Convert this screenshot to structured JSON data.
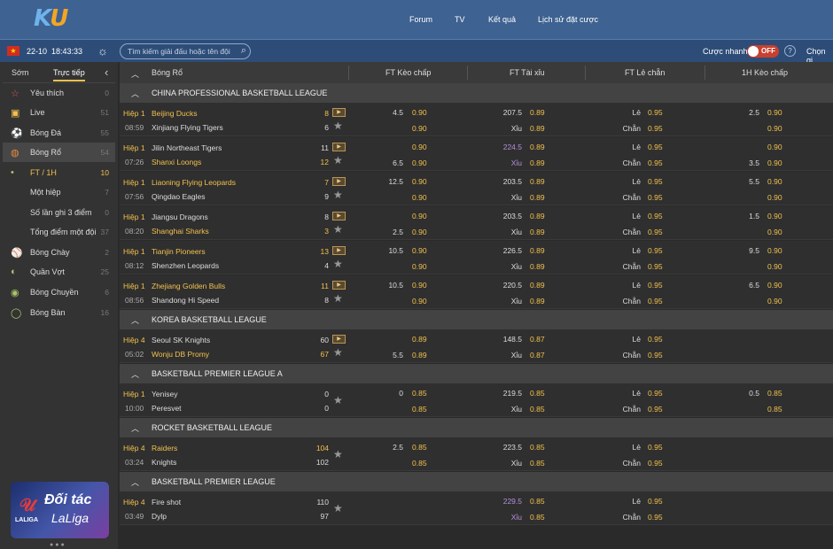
{
  "header": {
    "logo_k": "K",
    "logo_u": "U",
    "nav": [
      "Forum",
      "TV",
      "Kết quả",
      "Lịch sử đặt cược"
    ]
  },
  "topbar": {
    "flag": "★",
    "date": "22-10",
    "time": "18:43:33",
    "search_placeholder": "Tìm kiếm giải đấu hoặc tên đội",
    "quick_bet_label": "Cược nhanh",
    "toggle_state": "OFF",
    "help": "?",
    "select_label": "Chọn gi"
  },
  "sidebar": {
    "tabs": [
      "Sớm",
      "Trực tiếp"
    ],
    "collapse": "‹",
    "items": [
      {
        "icon": "☆",
        "label": "Yêu thích",
        "count": "0"
      },
      {
        "icon": "▣",
        "label": "Live",
        "count": "51"
      },
      {
        "icon": "⚽",
        "label": "Bóng Đá",
        "count": "55"
      },
      {
        "icon": "◍",
        "label": "Bóng Rổ",
        "count": "54"
      },
      {
        "icon": "•",
        "label": "FT / 1H",
        "count": "10"
      },
      {
        "icon": "",
        "label": "Một hiệp",
        "count": "7"
      },
      {
        "icon": "",
        "label": "Số lần ghi 3 điểm",
        "count": "0"
      },
      {
        "icon": "",
        "label": "Tổng điểm một đội",
        "count": "37"
      },
      {
        "icon": "⚾",
        "label": "Bóng Chày",
        "count": "2"
      },
      {
        "icon": "◐",
        "label": "Quần Vợt",
        "count": "25"
      },
      {
        "icon": "◉",
        "label": "Bóng Chuyền",
        "count": "6"
      },
      {
        "icon": "◯",
        "label": "Bóng Bàn",
        "count": "16"
      }
    ],
    "banner": {
      "line1": "Đối tác",
      "line2": "LaLiga",
      "brand": "LALIGA"
    }
  },
  "table": {
    "columns": [
      "Bóng Rổ",
      "FT Kèo chấp",
      "FT Tài xỉu",
      "FT Lẻ chẵn",
      "1H Kèo chấp"
    ],
    "leagues": [
      {
        "name": "CHINA PROFESSIONAL BASKETBALL LEAGUE",
        "matches": [
          {
            "period": "Hiệp 1",
            "time": "08:59",
            "home": "Beijing Ducks",
            "away": "Xinjiang Flying Tigers",
            "hs": "8",
            "as": "6",
            "fav": "home",
            "tv": true,
            "ft_hc": [
              "4.5",
              "0.90",
              "",
              "0.90"
            ],
            "ft_ou": [
              "207.5",
              "0.89",
              "Xỉu",
              "0.89"
            ],
            "ou_purple": false,
            "oe": [
              "Lẻ",
              "0.95",
              "Chẵn",
              "0.95"
            ],
            "h1": [
              "2.5",
              "0.90",
              "",
              "0.90"
            ]
          },
          {
            "period": "Hiệp 1",
            "time": "07:26",
            "home": "Jilin Northeast Tigers",
            "away": "Shanxi Loongs",
            "hs": "11",
            "as": "12",
            "fav": "away",
            "tv": true,
            "ft_hc": [
              "",
              "0.90",
              "6.5",
              "0.90"
            ],
            "ft_ou": [
              "224.5",
              "0.89",
              "Xỉu",
              "0.89"
            ],
            "ou_purple": true,
            "oe": [
              "Lẻ",
              "0.95",
              "Chẵn",
              "0.95"
            ],
            "h1": [
              "",
              "0.90",
              "3.5",
              "0.90"
            ]
          },
          {
            "period": "Hiệp 1",
            "time": "07:56",
            "home": "Liaoning Flying Leopards",
            "away": "Qingdao Eagles",
            "hs": "7",
            "as": "9",
            "fav": "home",
            "tv": true,
            "ft_hc": [
              "12.5",
              "0.90",
              "",
              "0.90"
            ],
            "ft_ou": [
              "203.5",
              "0.89",
              "Xỉu",
              "0.89"
            ],
            "ou_purple": false,
            "oe": [
              "Lẻ",
              "0.95",
              "Chẵn",
              "0.95"
            ],
            "h1": [
              "5.5",
              "0.90",
              "",
              "0.90"
            ]
          },
          {
            "period": "Hiệp 1",
            "time": "08:20",
            "home": "Jiangsu Dragons",
            "away": "Shanghai Sharks",
            "hs": "8",
            "as": "3",
            "fav": "away",
            "tv": true,
            "ft_hc": [
              "",
              "0.90",
              "2.5",
              "0.90"
            ],
            "ft_ou": [
              "203.5",
              "0.89",
              "Xỉu",
              "0.89"
            ],
            "ou_purple": false,
            "oe": [
              "Lẻ",
              "0.95",
              "Chẵn",
              "0.95"
            ],
            "h1": [
              "1.5",
              "0.90",
              "",
              "0.90"
            ]
          },
          {
            "period": "Hiệp 1",
            "time": "08:12",
            "home": "Tianjin Pioneers",
            "away": "Shenzhen Leopards",
            "hs": "13",
            "as": "4",
            "fav": "home",
            "tv": true,
            "ft_hc": [
              "10.5",
              "0.90",
              "",
              "0.90"
            ],
            "ft_ou": [
              "226.5",
              "0.89",
              "Xỉu",
              "0.89"
            ],
            "ou_purple": false,
            "oe": [
              "Lẻ",
              "0.95",
              "Chẵn",
              "0.95"
            ],
            "h1": [
              "9.5",
              "0.90",
              "",
              "0.90"
            ]
          },
          {
            "period": "Hiệp 1",
            "time": "08:56",
            "home": "Zhejiang Golden Bulls",
            "away": "Shandong Hi Speed",
            "hs": "11",
            "as": "8",
            "fav": "home",
            "tv": true,
            "ft_hc": [
              "10.5",
              "0.90",
              "",
              "0.90"
            ],
            "ft_ou": [
              "220.5",
              "0.89",
              "Xỉu",
              "0.89"
            ],
            "ou_purple": false,
            "oe": [
              "Lẻ",
              "0.95",
              "Chẵn",
              "0.95"
            ],
            "h1": [
              "6.5",
              "0.90",
              "",
              "0.90"
            ]
          }
        ]
      },
      {
        "name": "KOREA BASKETBALL LEAGUE",
        "matches": [
          {
            "period": "Hiệp 4",
            "time": "05:02",
            "home": "Seoul SK Knights",
            "away": "Wonju DB Promy",
            "hs": "60",
            "as": "67",
            "fav": "away",
            "tv": true,
            "ft_hc": [
              "",
              "0.89",
              "5.5",
              "0.89"
            ],
            "ft_ou": [
              "148.5",
              "0.87",
              "Xỉu",
              "0.87"
            ],
            "ou_purple": false,
            "oe": [
              "Lẻ",
              "0.95",
              "Chẵn",
              "0.95"
            ],
            "h1": [
              "",
              "",
              "",
              ""
            ]
          }
        ]
      },
      {
        "name": "BASKETBALL PREMIER LEAGUE A",
        "matches": [
          {
            "period": "Hiệp 1",
            "time": "10:00",
            "home": "Yenisey",
            "away": "Peresvet",
            "hs": "0",
            "as": "0",
            "fav": "none",
            "tv": false,
            "ft_hc": [
              "0",
              "0.85",
              "",
              "0.85"
            ],
            "ft_ou": [
              "219.5",
              "0.85",
              "Xỉu",
              "0.85"
            ],
            "ou_purple": false,
            "oe": [
              "Lẻ",
              "0.95",
              "Chẵn",
              "0.95"
            ],
            "h1": [
              "0.5",
              "0.85",
              "",
              "0.85"
            ]
          }
        ]
      },
      {
        "name": "ROCKET BASKETBALL LEAGUE",
        "matches": [
          {
            "period": "Hiệp 4",
            "time": "03:24",
            "home": "Raiders",
            "away": "Knights",
            "hs": "104",
            "as": "102",
            "fav": "home",
            "tv": false,
            "ft_hc": [
              "2.5",
              "0.85",
              "",
              "0.85"
            ],
            "ft_ou": [
              "223.5",
              "0.85",
              "Xỉu",
              "0.85"
            ],
            "ou_purple": false,
            "oe": [
              "Lẻ",
              "0.95",
              "Chẵn",
              "0.95"
            ],
            "h1": [
              "",
              "",
              "",
              ""
            ]
          }
        ]
      },
      {
        "name": "BASKETBALL PREMIER LEAGUE",
        "matches": [
          {
            "period": "Hiệp 4",
            "time": "03:49",
            "home": "Fire shot",
            "away": "Dylp",
            "hs": "110",
            "as": "97",
            "fav": "none",
            "tv": false,
            "ft_hc": [
              "",
              "",
              "",
              ""
            ],
            "ft_ou": [
              "229.5",
              "0.85",
              "Xỉu",
              "0.85"
            ],
            "ou_purple": true,
            "oe": [
              "Lẻ",
              "0.95",
              "Chẵn",
              "0.95"
            ],
            "h1": [
              "",
              "",
              "",
              ""
            ]
          }
        ]
      }
    ]
  },
  "colors": {
    "header_bg": "#3e6291",
    "accent": "#f2c14e",
    "purple": "#b590d9",
    "toggle_off": "#c8402f"
  }
}
